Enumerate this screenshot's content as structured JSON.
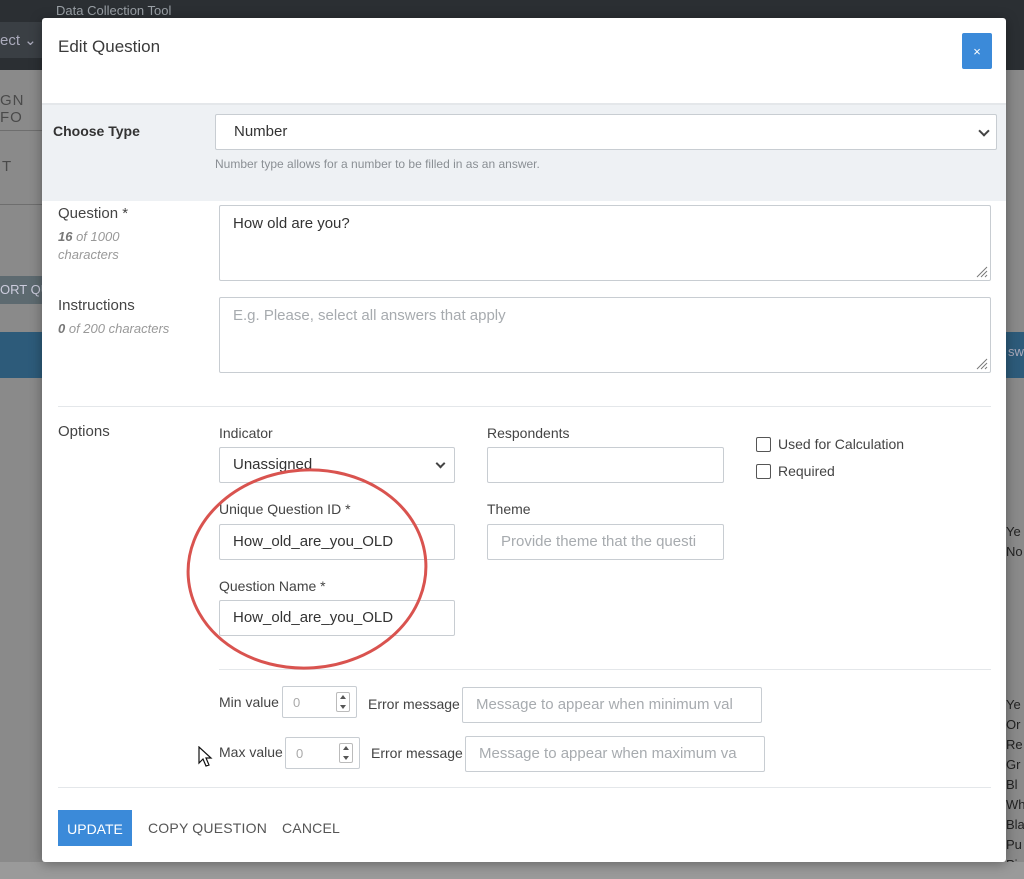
{
  "app": {
    "title": "Data Collection Tool",
    "select_partial": "ect",
    "side_text_1": "GN FO",
    "side_text_2": "T",
    "side_button_partial": "ORT QU",
    "right_partial_1": [
      "Ye",
      "No"
    ],
    "right_partial_2": [
      "Ye",
      "Or",
      "Re",
      "Gr",
      "Bl",
      "Wh",
      "Bla",
      "Pu",
      "Pi"
    ],
    "blue_bar_partial": "sw"
  },
  "modal": {
    "title": "Edit Question",
    "close_label": "×",
    "choose_type": {
      "label": "Choose Type",
      "selected": "Number",
      "help": "Number type allows for a number to be filled in as an answer."
    },
    "question": {
      "label": "Question *",
      "count": "16",
      "count_suffix": " of 1000",
      "count_suffix2": "characters",
      "value": "How old are you?"
    },
    "instructions": {
      "label": "Instructions",
      "count": "0",
      "count_suffix": " of 200 characters",
      "placeholder": "E.g. Please, select all answers that apply"
    },
    "options": {
      "label": "Options",
      "indicator_label": "Indicator",
      "indicator_value": "Unassigned",
      "respondents_label": "Respondents",
      "respondents_value": "",
      "used_for_calculation": "Used for Calculation",
      "required": "Required",
      "unique_id_label": "Unique Question ID *",
      "unique_id_value": "How_old_are_you_OLD",
      "theme_label": "Theme",
      "theme_placeholder": "Provide theme that the questi",
      "question_name_label": "Question Name *",
      "question_name_value": "How_old_are_you_OLD"
    },
    "limits": {
      "min_label": "Min value",
      "min_value": "0",
      "min_error_label": "Error message",
      "min_error_placeholder": "Message to appear when minimum val",
      "max_label": "Max value",
      "max_value": "0",
      "max_error_label": "Error message",
      "max_error_placeholder": "Message to appear when maximum va"
    },
    "footer": {
      "update": "UPDATE",
      "copy": "COPY QUESTION",
      "cancel": "CANCEL"
    }
  },
  "colors": {
    "primary": "#3b8ad9",
    "annotation": "#d9534f"
  }
}
